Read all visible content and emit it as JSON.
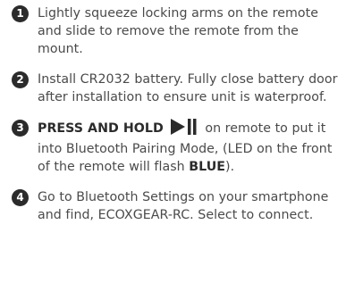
{
  "steps": [
    {
      "number": "1",
      "text": "Lightly squeeze locking arms on the remote and slide to remove the remote from the mount."
    },
    {
      "number": "2",
      "text": "Install CR2032 battery. Fully close battery door after installation to ensure unit is waterproof."
    },
    {
      "number": "3",
      "emphasis": "PRESS AND HOLD",
      "icon": "play-pause-icon",
      "text_after_icon": " on remote to put it into Bluetooth Pairing Mode, (LED on the front of the remote will flash ",
      "color_word": "BLUE",
      "text_end": ")."
    },
    {
      "number": "4",
      "text": "Go to Bluetooth Settings on your smartphone and find, ECOXGEAR-RC. Select to connect."
    }
  ]
}
